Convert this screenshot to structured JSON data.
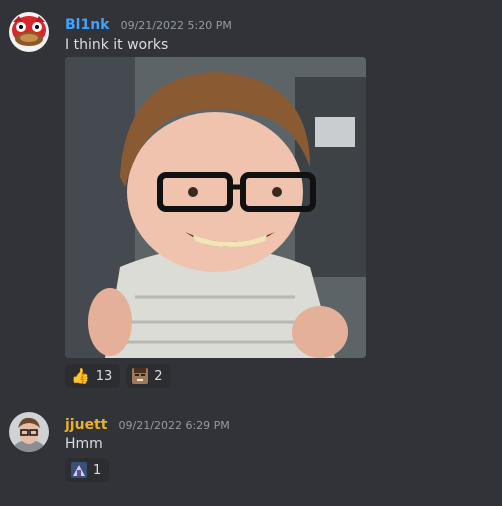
{
  "messages": [
    {
      "username": "Bl1nk",
      "username_color": "#3ea4ff",
      "timestamp": "09/21/2022 5:20 PM",
      "text": "I think it works",
      "avatar": "ugandan-knuckles-avatar",
      "attachment": "meme-image-smiling-person-with-glasses",
      "reactions": [
        {
          "icon": "thumbs-up-icon",
          "count": "13"
        },
        {
          "icon": "face-emoji-icon",
          "count": "2"
        }
      ]
    },
    {
      "username": "jjuett",
      "username_color": "#e5b32b",
      "timestamp": "09/21/2022 6:29 PM",
      "text": "Hmm",
      "avatar": "glasses-person-avatar",
      "reactions": [
        {
          "icon": "custom-emoji-icon",
          "count": "1"
        }
      ]
    }
  ]
}
